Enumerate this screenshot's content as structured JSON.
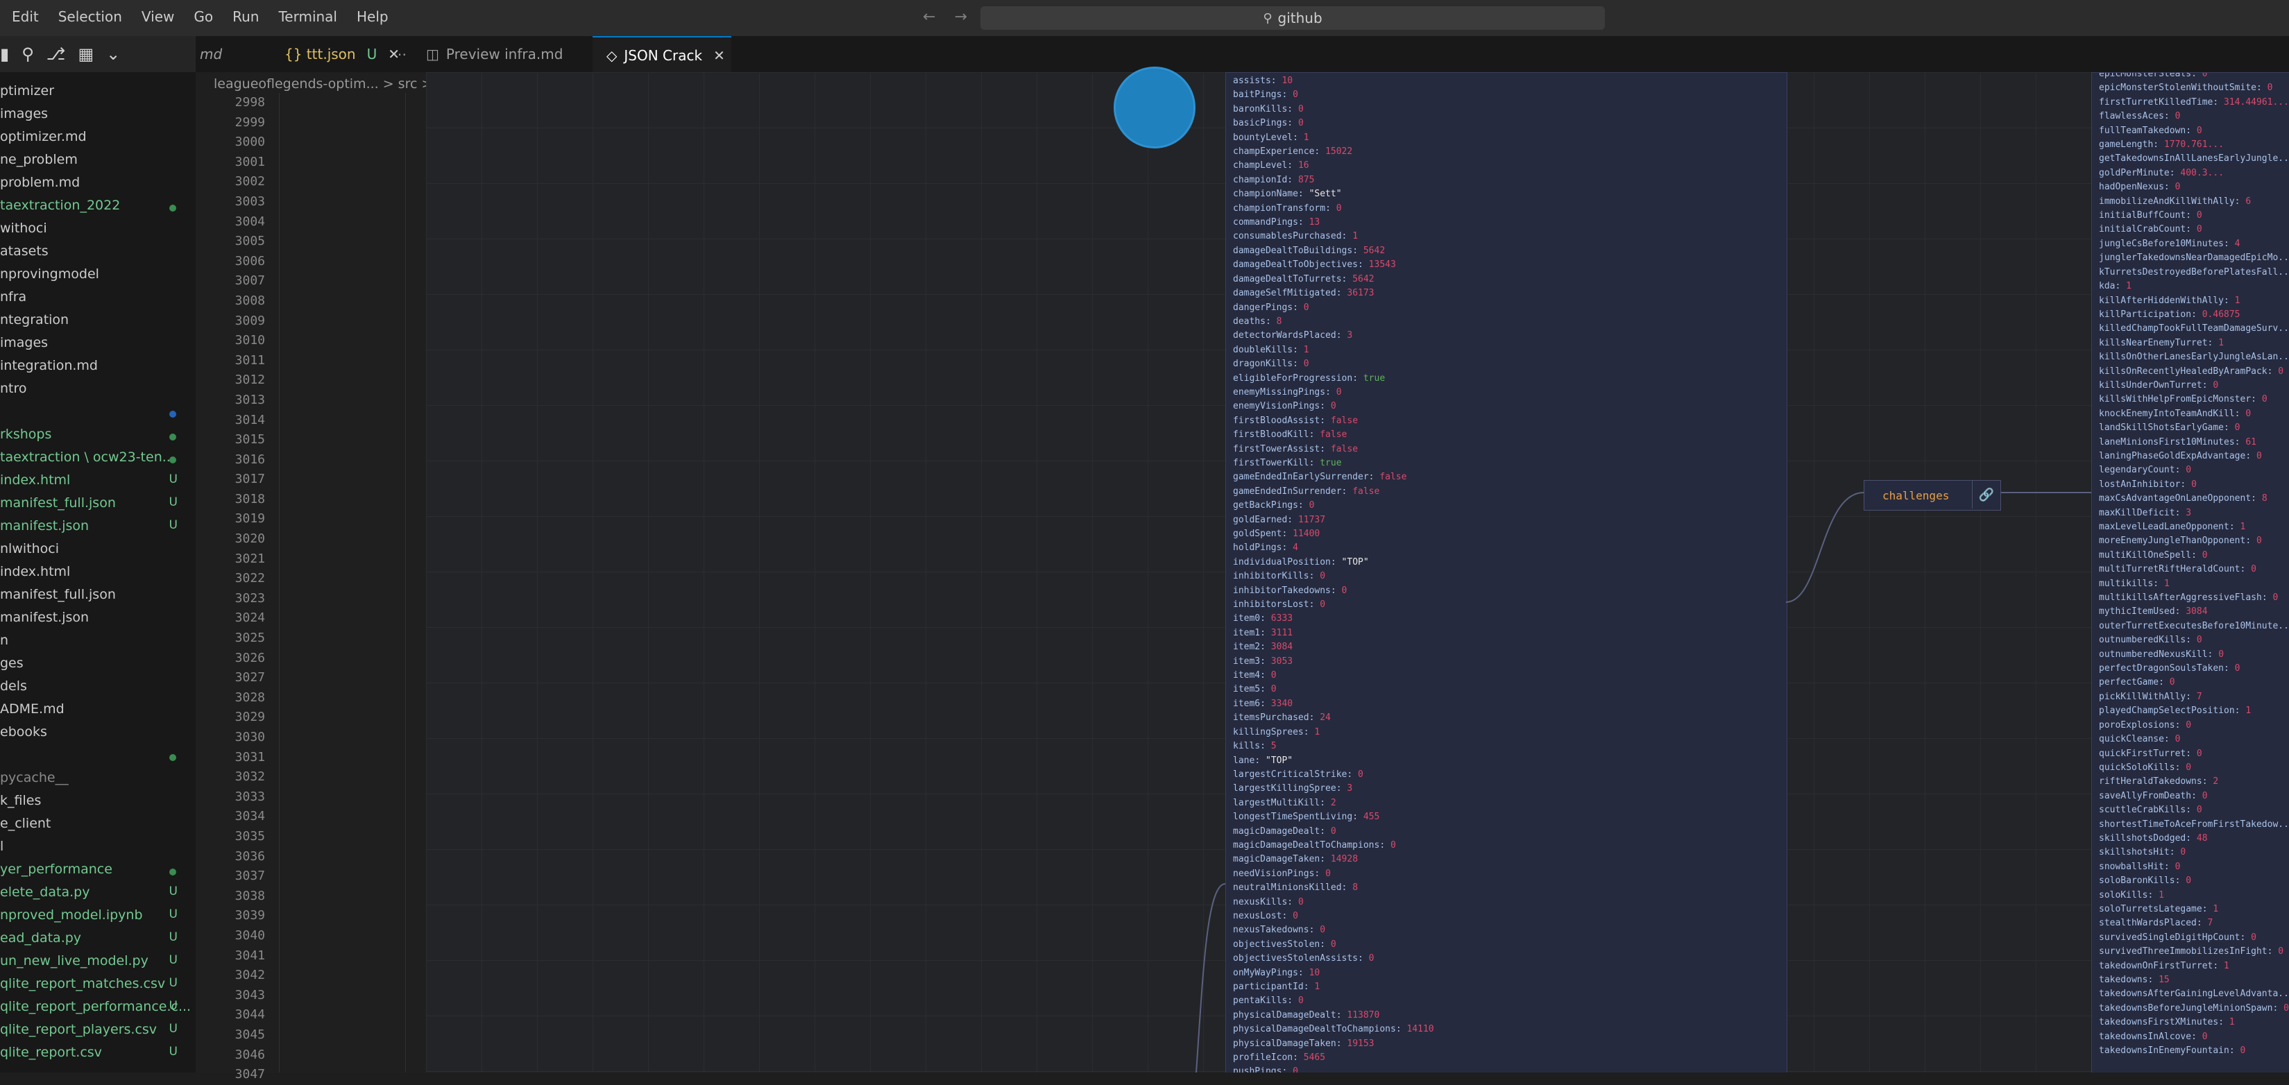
{
  "menu": [
    "Edit",
    "Selection",
    "View",
    "Go",
    "Run",
    "Terminal",
    "Help"
  ],
  "search_text": "github",
  "tabs": [
    {
      "label": "md"
    },
    {
      "label": "{} ttt.json",
      "status": "U"
    },
    {
      "label": "Preview infra.md"
    },
    {
      "label": "JSON Crack"
    }
  ],
  "breadcrumb": "leagueoflegends-optim... > src > {}",
  "line_numbers": [
    "2998",
    "2999",
    "3000",
    "3001",
    "3002",
    "3003",
    "3004",
    "3005",
    "3006",
    "3007",
    "3008",
    "3009",
    "3010",
    "3011",
    "3012",
    "3013",
    "3014",
    "3015",
    "3016",
    "3017",
    "3018",
    "3019",
    "3020",
    "3021",
    "3022",
    "3023",
    "3024",
    "3025",
    "3026",
    "3027",
    "3028",
    "3029",
    "3030",
    "3031",
    "3032",
    "3033",
    "3034",
    "3035",
    "3036",
    "3037",
    "3038",
    "3039",
    "3040",
    "3041",
    "3042",
    "3043",
    "3044",
    "3045",
    "3046",
    "3047"
  ],
  "explorer": [
    {
      "label": "ptimizer",
      "color": "#cccccc"
    },
    {
      "label": "images",
      "color": "#cccccc"
    },
    {
      "label": "optimizer.md",
      "color": "#cccccc"
    },
    {
      "label": "ne_problem",
      "color": "#cccccc"
    },
    {
      "label": "problem.md",
      "color": "#cccccc"
    },
    {
      "label": "taextraction_2022",
      "color": "#73c991",
      "dot": "green"
    },
    {
      "label": "withoci",
      "color": "#cccccc"
    },
    {
      "label": "atasets",
      "color": "#cccccc"
    },
    {
      "label": "nprovingmodel",
      "color": "#cccccc"
    },
    {
      "label": "nfra",
      "color": "#cccccc"
    },
    {
      "label": "ntegration",
      "color": "#cccccc"
    },
    {
      "label": "images",
      "color": "#cccccc"
    },
    {
      "label": "integration.md",
      "color": "#cccccc"
    },
    {
      "label": "ntro",
      "color": "#cccccc"
    },
    {
      "label": "",
      "color": "#cccccc",
      "dot": "blue"
    },
    {
      "label": "rkshops",
      "color": "#73c991",
      "dot": "green"
    },
    {
      "label": "taextraction \\ ocw23-ten...",
      "color": "#73c991",
      "dot": "green"
    },
    {
      "label": "index.html",
      "color": "#73c991",
      "mark": "U"
    },
    {
      "label": "manifest_full.json",
      "color": "#73c991",
      "mark": "U"
    },
    {
      "label": "manifest.json",
      "color": "#73c991",
      "mark": "U"
    },
    {
      "label": "nlwithoci",
      "color": "#cccccc"
    },
    {
      "label": "index.html",
      "color": "#cccccc"
    },
    {
      "label": "manifest_full.json",
      "color": "#cccccc"
    },
    {
      "label": "manifest.json",
      "color": "#cccccc"
    },
    {
      "label": "n",
      "color": "#cccccc"
    },
    {
      "label": "ges",
      "color": "#cccccc"
    },
    {
      "label": "dels",
      "color": "#cccccc"
    },
    {
      "label": "ADME.md",
      "color": "#cccccc"
    },
    {
      "label": "ebooks",
      "color": "#cccccc"
    },
    {
      "label": "",
      "color": "#cccccc",
      "dot": "green"
    },
    {
      "label": "pycache__",
      "color": "#8a8a8a"
    },
    {
      "label": "k_files",
      "color": "#cccccc"
    },
    {
      "label": "e_client",
      "color": "#cccccc"
    },
    {
      "label": "l",
      "color": "#cccccc"
    },
    {
      "label": "yer_performance",
      "color": "#73c991",
      "dot": "green"
    },
    {
      "label": "elete_data.py",
      "color": "#73c991",
      "mark": "U"
    },
    {
      "label": "nproved_model.ipynb",
      "color": "#73c991",
      "mark": "U"
    },
    {
      "label": "ead_data.py",
      "color": "#73c991",
      "mark": "U"
    },
    {
      "label": "un_new_live_model.py",
      "color": "#73c991",
      "mark": "U"
    },
    {
      "label": "qlite_report_matches.csv",
      "color": "#73c991",
      "mark": "U"
    },
    {
      "label": "qlite_report_performance.c...",
      "color": "#73c991",
      "mark": "U"
    },
    {
      "label": "qlite_report_players.csv",
      "color": "#73c991",
      "mark": "U"
    },
    {
      "label": "qlite_report.csv",
      "color": "#73c991",
      "mark": "U"
    }
  ],
  "left_node": [
    {
      "k": "assists",
      "v": "10",
      "t": "n"
    },
    {
      "k": "baitPings",
      "v": "0",
      "t": "n"
    },
    {
      "k": "baronKills",
      "v": "0",
      "t": "n"
    },
    {
      "k": "basicPings",
      "v": "0",
      "t": "n"
    },
    {
      "k": "bountyLevel",
      "v": "1",
      "t": "n"
    },
    {
      "k": "champExperience",
      "v": "15022",
      "t": "n"
    },
    {
      "k": "champLevel",
      "v": "16",
      "t": "n"
    },
    {
      "k": "championId",
      "v": "875",
      "t": "n"
    },
    {
      "k": "championName",
      "v": "\"Sett\"",
      "t": "s"
    },
    {
      "k": "championTransform",
      "v": "0",
      "t": "n"
    },
    {
      "k": "commandPings",
      "v": "13",
      "t": "n"
    },
    {
      "k": "consumablesPurchased",
      "v": "1",
      "t": "n"
    },
    {
      "k": "damageDealtToBuildings",
      "v": "5642",
      "t": "n"
    },
    {
      "k": "damageDealtToObjectives",
      "v": "13543",
      "t": "n"
    },
    {
      "k": "damageDealtToTurrets",
      "v": "5642",
      "t": "n"
    },
    {
      "k": "damageSelfMitigated",
      "v": "36173",
      "t": "n"
    },
    {
      "k": "dangerPings",
      "v": "0",
      "t": "n"
    },
    {
      "k": "deaths",
      "v": "8",
      "t": "n"
    },
    {
      "k": "detectorWardsPlaced",
      "v": "3",
      "t": "n"
    },
    {
      "k": "doubleKills",
      "v": "1",
      "t": "n"
    },
    {
      "k": "dragonKills",
      "v": "0",
      "t": "n"
    },
    {
      "k": "eligibleForProgression",
      "v": "true",
      "t": "b"
    },
    {
      "k": "enemyMissingPings",
      "v": "0",
      "t": "n"
    },
    {
      "k": "enemyVisionPings",
      "v": "0",
      "t": "n"
    },
    {
      "k": "firstBloodAssist",
      "v": "false",
      "t": "n"
    },
    {
      "k": "firstBloodKill",
      "v": "false",
      "t": "n"
    },
    {
      "k": "firstTowerAssist",
      "v": "false",
      "t": "n"
    },
    {
      "k": "firstTowerKill",
      "v": "true",
      "t": "b"
    },
    {
      "k": "gameEndedInEarlySurrender",
      "v": "false",
      "t": "n"
    },
    {
      "k": "gameEndedInSurrender",
      "v": "false",
      "t": "n"
    },
    {
      "k": "getBackPings",
      "v": "0",
      "t": "n"
    },
    {
      "k": "goldEarned",
      "v": "11737",
      "t": "n"
    },
    {
      "k": "goldSpent",
      "v": "11400",
      "t": "n"
    },
    {
      "k": "holdPings",
      "v": "4",
      "t": "n"
    },
    {
      "k": "individualPosition",
      "v": "\"TOP\"",
      "t": "s"
    },
    {
      "k": "inhibitorKills",
      "v": "0",
      "t": "n"
    },
    {
      "k": "inhibitorTakedowns",
      "v": "0",
      "t": "n"
    },
    {
      "k": "inhibitorsLost",
      "v": "0",
      "t": "n"
    },
    {
      "k": "item0",
      "v": "6333",
      "t": "n"
    },
    {
      "k": "item1",
      "v": "3111",
      "t": "n"
    },
    {
      "k": "item2",
      "v": "3084",
      "t": "n"
    },
    {
      "k": "item3",
      "v": "3053",
      "t": "n"
    },
    {
      "k": "item4",
      "v": "0",
      "t": "n"
    },
    {
      "k": "item5",
      "v": "0",
      "t": "n"
    },
    {
      "k": "item6",
      "v": "3340",
      "t": "n"
    },
    {
      "k": "itemsPurchased",
      "v": "24",
      "t": "n"
    },
    {
      "k": "killingSprees",
      "v": "1",
      "t": "n"
    },
    {
      "k": "kills",
      "v": "5",
      "t": "n"
    },
    {
      "k": "lane",
      "v": "\"TOP\"",
      "t": "s"
    },
    {
      "k": "largestCriticalStrike",
      "v": "0",
      "t": "n"
    },
    {
      "k": "largestKillingSpree",
      "v": "3",
      "t": "n"
    },
    {
      "k": "largestMultiKill",
      "v": "2",
      "t": "n"
    },
    {
      "k": "longestTimeSpentLiving",
      "v": "455",
      "t": "n"
    },
    {
      "k": "magicDamageDealt",
      "v": "0",
      "t": "n"
    },
    {
      "k": "magicDamageDealtToChampions",
      "v": "0",
      "t": "n"
    },
    {
      "k": "magicDamageTaken",
      "v": "14928",
      "t": "n"
    },
    {
      "k": "needVisionPings",
      "v": "0",
      "t": "n"
    },
    {
      "k": "neutralMinionsKilled",
      "v": "8",
      "t": "n"
    },
    {
      "k": "nexusKills",
      "v": "0",
      "t": "n"
    },
    {
      "k": "nexusLost",
      "v": "0",
      "t": "n"
    },
    {
      "k": "nexusTakedowns",
      "v": "0",
      "t": "n"
    },
    {
      "k": "objectivesStolen",
      "v": "0",
      "t": "n"
    },
    {
      "k": "objectivesStolenAssists",
      "v": "0",
      "t": "n"
    },
    {
      "k": "onMyWayPings",
      "v": "10",
      "t": "n"
    },
    {
      "k": "participantId",
      "v": "1",
      "t": "n"
    },
    {
      "k": "pentaKills",
      "v": "0",
      "t": "n"
    },
    {
      "k": "physicalDamageDealt",
      "v": "113870",
      "t": "n"
    },
    {
      "k": "physicalDamageDealtToChampions",
      "v": "14110",
      "t": "n"
    },
    {
      "k": "physicalDamageTaken",
      "v": "19153",
      "t": "n"
    },
    {
      "k": "profileIcon",
      "v": "5465",
      "t": "n"
    },
    {
      "k": "pushPings",
      "v": "0",
      "t": "n"
    }
  ],
  "right_node": [
    {
      "k": "epicMonsterSteals",
      "v": "0"
    },
    {
      "k": "epicMonsterStolenWithoutSmite",
      "v": "0"
    },
    {
      "k": "firstTurretKilledTime",
      "v": "314.44961..."
    },
    {
      "k": "flawlessAces",
      "v": "0"
    },
    {
      "k": "fullTeamTakedown",
      "v": "0"
    },
    {
      "k": "gameLength",
      "v": "1770.761..."
    },
    {
      "k": "getTakedownsInAllLanesEarlyJungle...",
      "v": ""
    },
    {
      "k": "goldPerMinute",
      "v": "400.3..."
    },
    {
      "k": "hadOpenNexus",
      "v": "0"
    },
    {
      "k": "immobilizeAndKillWithAlly",
      "v": "6"
    },
    {
      "k": "initialBuffCount",
      "v": "0"
    },
    {
      "k": "initialCrabCount",
      "v": "0"
    },
    {
      "k": "jungleCsBefore10Minutes",
      "v": "4"
    },
    {
      "k": "junglerTakedownsNearDamagedEpicMo...",
      "v": ""
    },
    {
      "k": "kTurretsDestroyedBeforePlatesFall...",
      "v": ""
    },
    {
      "k": "kda",
      "v": "1"
    },
    {
      "k": "killAfterHiddenWithAlly",
      "v": "1"
    },
    {
      "k": "killParticipation",
      "v": "0.46875"
    },
    {
      "k": "killedChampTookFullTeamDamageSurv...",
      "v": ""
    },
    {
      "k": "killsNearEnemyTurret",
      "v": "1"
    },
    {
      "k": "killsOnOtherLanesEarlyJungleAsLan...",
      "v": ""
    },
    {
      "k": "killsOnRecentlyHealedByAramPack",
      "v": "0"
    },
    {
      "k": "killsUnderOwnTurret",
      "v": "0"
    },
    {
      "k": "killsWithHelpFromEpicMonster",
      "v": "0"
    },
    {
      "k": "knockEnemyIntoTeamAndKill",
      "v": "0"
    },
    {
      "k": "landSkillShotsEarlyGame",
      "v": "0"
    },
    {
      "k": "laneMinionsFirst10Minutes",
      "v": "61"
    },
    {
      "k": "laningPhaseGoldExpAdvantage",
      "v": "0"
    },
    {
      "k": "legendaryCount",
      "v": "0"
    },
    {
      "k": "lostAnInhibitor",
      "v": "0"
    },
    {
      "k": "maxCsAdvantageOnLaneOpponent",
      "v": "8"
    },
    {
      "k": "maxKillDeficit",
      "v": "3"
    },
    {
      "k": "maxLevelLeadLaneOpponent",
      "v": "1"
    },
    {
      "k": "moreEnemyJungleThanOpponent",
      "v": "0"
    },
    {
      "k": "multiKillOneSpell",
      "v": "0"
    },
    {
      "k": "multiTurretRiftHeraldCount",
      "v": "0"
    },
    {
      "k": "multikills",
      "v": "1"
    },
    {
      "k": "multikillsAfterAggressiveFlash",
      "v": "0"
    },
    {
      "k": "mythicItemUsed",
      "v": "3084"
    },
    {
      "k": "outerTurretExecutesBefore10Minute...",
      "v": ""
    },
    {
      "k": "outnumberedKills",
      "v": "0"
    },
    {
      "k": "outnumberedNexusKill",
      "v": "0"
    },
    {
      "k": "perfectDragonSoulsTaken",
      "v": "0"
    },
    {
      "k": "perfectGame",
      "v": "0"
    },
    {
      "k": "pickKillWithAlly",
      "v": "7"
    },
    {
      "k": "playedChampSelectPosition",
      "v": "1"
    },
    {
      "k": "poroExplosions",
      "v": "0"
    },
    {
      "k": "quickCleanse",
      "v": "0"
    },
    {
      "k": "quickFirstTurret",
      "v": "0"
    },
    {
      "k": "quickSoloKills",
      "v": "0"
    },
    {
      "k": "riftHeraldTakedowns",
      "v": "2"
    },
    {
      "k": "saveAllyFromDeath",
      "v": "0"
    },
    {
      "k": "scuttleCrabKills",
      "v": "0"
    },
    {
      "k": "shortestTimeToAceFromFirstTakedow...",
      "v": ""
    },
    {
      "k": "skillshotsDodged",
      "v": "48"
    },
    {
      "k": "skillshotsHit",
      "v": "0"
    },
    {
      "k": "snowballsHit",
      "v": "0"
    },
    {
      "k": "soloBaronKills",
      "v": "0"
    },
    {
      "k": "soloKills",
      "v": "1"
    },
    {
      "k": "soloTurretsLategame",
      "v": "1"
    },
    {
      "k": "stealthWardsPlaced",
      "v": "7"
    },
    {
      "k": "survivedSingleDigitHpCount",
      "v": "0"
    },
    {
      "k": "survivedThreeImmobilizesInFight",
      "v": "0"
    },
    {
      "k": "takedownOnFirstTurret",
      "v": "1"
    },
    {
      "k": "takedowns",
      "v": "15"
    },
    {
      "k": "takedownsAfterGainingLevelAdvanta...",
      "v": ""
    },
    {
      "k": "takedownsBeforeJungleMinionSpawn",
      "v": "0"
    },
    {
      "k": "takedownsFirstXMinutes",
      "v": "1"
    },
    {
      "k": "takedownsInAlcove",
      "v": "0"
    },
    {
      "k": "takedownsInEnemyFountain",
      "v": "0"
    }
  ],
  "challenges_chip": "challenges",
  "colors": {
    "accent": "#007acc",
    "untracked": "#73c991",
    "value": "#d94a6c",
    "bool": "#5fb35a",
    "key": "#a9c2e8",
    "chip": "#e9a045"
  }
}
